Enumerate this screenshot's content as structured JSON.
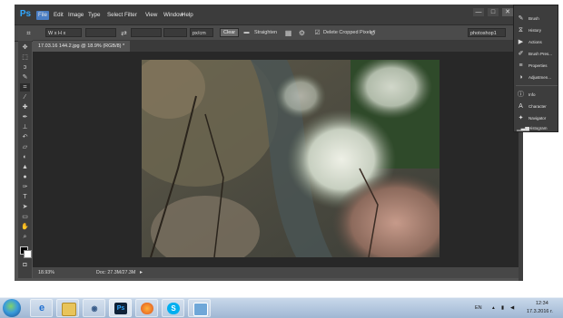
{
  "app": {
    "logo": "Ps",
    "menu": [
      "File",
      "Edit",
      "Image",
      "Type",
      "Select",
      "Filter",
      "View",
      "Window",
      "Help"
    ],
    "active_menu": "File",
    "window_controls": [
      "—",
      "□",
      "✕"
    ]
  },
  "options_bar": {
    "ratio_preset": "W x H x Res...",
    "unit": "px/cm",
    "clear_label": "Clear",
    "straighten_label": "Straighten",
    "delete_cropped_label": "Delete Cropped Pixels",
    "delete_cropped_checked": true,
    "workspace": "photoshop1"
  },
  "document": {
    "tab_title": "17.03.16 144.2.jpg @ 18.9% (RGB/8) *",
    "zoom": "18.93%",
    "doc_info": "Doc: 27.3M/27.3M"
  },
  "tools": [
    "move",
    "marquee",
    "lasso",
    "quick-select",
    "crop",
    "eyedropper",
    "healing-brush",
    "brush",
    "clone-stamp",
    "history-brush",
    "eraser",
    "gradient",
    "blur",
    "dodge",
    "pen",
    "type",
    "path-select",
    "rectangle",
    "hand",
    "zoom",
    "colors",
    "quick-mask"
  ],
  "panels": [
    {
      "label": "Brush",
      "icon": "brush-icon"
    },
    {
      "label": "History",
      "icon": "history-icon"
    },
    {
      "label": "Actions",
      "icon": "actions-icon"
    },
    {
      "label": "Brush Pres...",
      "icon": "brush-presets-icon"
    },
    {
      "label": "Properties",
      "icon": "properties-icon"
    },
    {
      "label": "Adjustmen...",
      "icon": "adjustments-icon"
    },
    {
      "label": "Info",
      "icon": "info-icon"
    },
    {
      "label": "Character",
      "icon": "character-icon"
    },
    {
      "label": "Navigator",
      "icon": "navigator-icon"
    },
    {
      "label": "Histogram",
      "icon": "histogram-icon"
    }
  ],
  "taskbar": {
    "apps": [
      "internet-explorer",
      "file-explorer",
      "photos",
      "photoshop",
      "firefox",
      "skype",
      "image-viewer"
    ],
    "active_app": "photoshop",
    "language": "EN",
    "time": "12:34",
    "date": "17.3.2016 г."
  },
  "colors": {
    "ps_blue": "#31a8ff",
    "menu_highlight": "#4a7ec4",
    "taskbar_top": "#c9d8ea"
  }
}
